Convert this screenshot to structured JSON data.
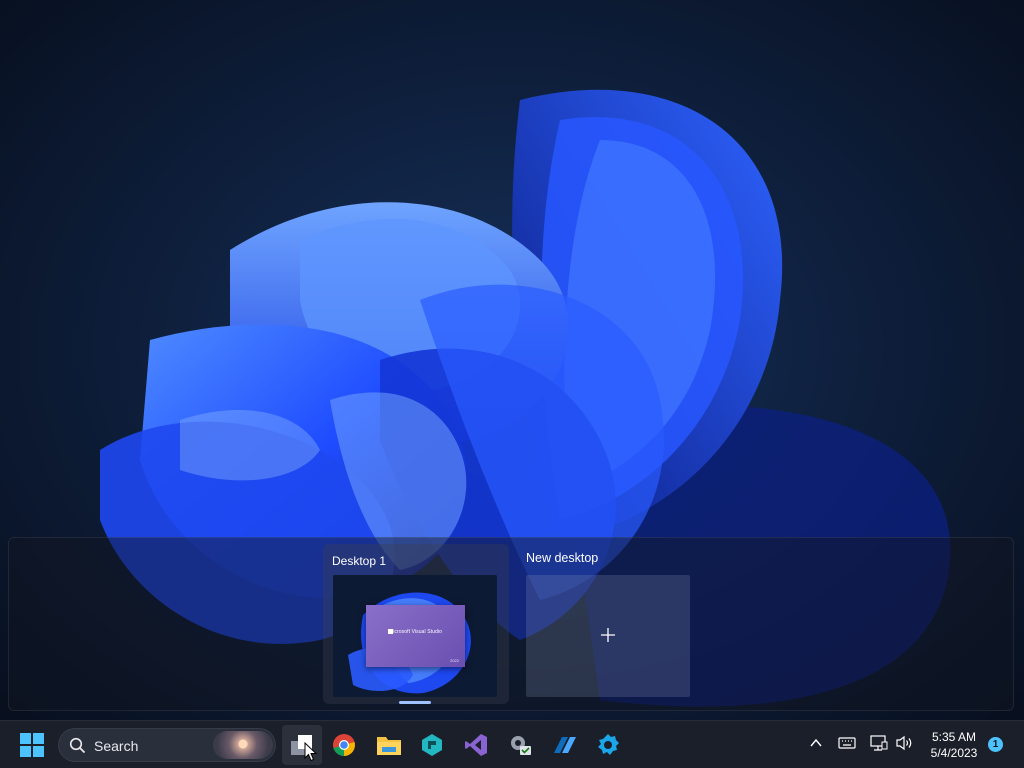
{
  "task_view": {
    "desktops": [
      {
        "label": "Desktop 1",
        "active": true,
        "windows": [
          {
            "title": "Microsoft Visual Studio",
            "version": "2022"
          }
        ]
      },
      {
        "label": "New desktop"
      }
    ]
  },
  "taskbar": {
    "search": {
      "label": "Search"
    },
    "pinned_apps": [
      {
        "name": "Task View",
        "icon": "task-view-icon"
      },
      {
        "name": "Google Chrome",
        "icon": "chrome-icon"
      },
      {
        "name": "File Explorer",
        "icon": "file-explorer-icon"
      },
      {
        "name": "Tool app",
        "icon": "tool-app-icon"
      },
      {
        "name": "Visual Studio",
        "icon": "visual-studio-icon"
      },
      {
        "name": "Settings tool",
        "icon": "settings-check-icon"
      },
      {
        "name": "Power Automate",
        "icon": "power-automate-icon"
      },
      {
        "name": "Configuration app",
        "icon": "gear-app-icon"
      }
    ],
    "tray": {
      "time": "5:35 AM",
      "date": "5/4/2023",
      "notification_count": "1"
    }
  },
  "colors": {
    "accent": "#4cc2ff",
    "wallpaper_bloom": "#1f4dff",
    "taskbar": "#1b1f2a"
  }
}
